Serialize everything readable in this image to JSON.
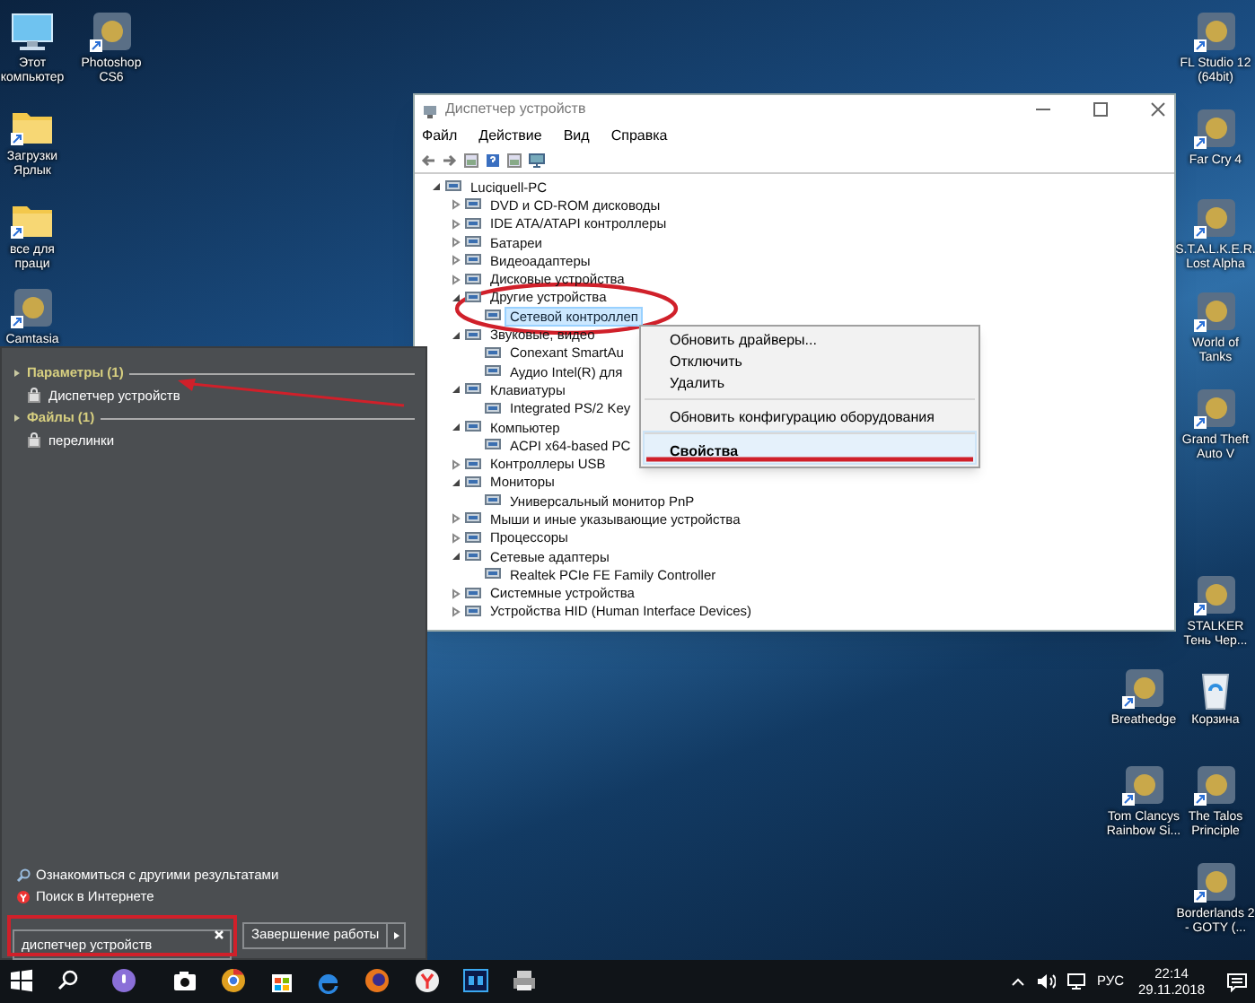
{
  "desktop_icons": [
    {
      "label": "Этот компьютер",
      "kind": "computer"
    },
    {
      "label": "Photoshop CS6",
      "kind": "app"
    },
    {
      "label": "Загрузки Ярлык",
      "kind": "folder"
    },
    {
      "label": "все для праци",
      "kind": "folder"
    },
    {
      "label": "Camtasia",
      "kind": "app"
    },
    {
      "label": "FL Studio 12 (64bit)",
      "kind": "app"
    },
    {
      "label": "Far Cry 4",
      "kind": "app"
    },
    {
      "label": "S.T.A.L.K.E.R. Lost Alpha",
      "kind": "app"
    },
    {
      "label": "World of Tanks",
      "kind": "app"
    },
    {
      "label": "Grand Theft Auto V",
      "kind": "app"
    },
    {
      "label": "STALKER Тень Чер...",
      "kind": "app"
    },
    {
      "label": "Breathedge",
      "kind": "app"
    },
    {
      "label": "Корзина",
      "kind": "bin"
    },
    {
      "label": "Tom Clancys Rainbow Si...",
      "kind": "app"
    },
    {
      "label": "The Talos Principle",
      "kind": "app"
    },
    {
      "label": "Borderlands 2 - GOTY (...",
      "kind": "app"
    }
  ],
  "device_manager": {
    "title": "Диспетчер устройств",
    "menu": [
      "Файл",
      "Действие",
      "Вид",
      "Справка"
    ],
    "tree": [
      {
        "label": "Luciquell-PC",
        "expanded": true,
        "selected": false,
        "children": [
          {
            "label": "DVD и CD-ROM дисководы",
            "expanded": false,
            "selected": false
          },
          {
            "label": "IDE ATA/ATAPI контроллеры",
            "expanded": false,
            "selected": false
          },
          {
            "label": "Батареи",
            "expanded": false,
            "selected": false
          },
          {
            "label": "Видеоадаптеры",
            "expanded": false,
            "selected": false
          },
          {
            "label": "Дисковые устройства",
            "expanded": false,
            "selected": false
          },
          {
            "label": "Другие устройства",
            "expanded": true,
            "selected": false,
            "children": [
              {
                "label": "Сетевой контроллеп",
                "selected": true
              }
            ]
          },
          {
            "label": "Звуковые, видео",
            "expanded": true,
            "selected": false,
            "children": [
              {
                "label": "Conexant SmartAu",
                "selected": false
              },
              {
                "label": "Аудио Intel(R) для",
                "selected": false
              }
            ]
          },
          {
            "label": "Клавиатуры",
            "expanded": true,
            "selected": false,
            "children": [
              {
                "label": "Integrated PS/2 Key",
                "selected": false
              }
            ]
          },
          {
            "label": "Компьютер",
            "expanded": true,
            "selected": false,
            "children": [
              {
                "label": "ACPI x64-based PC",
                "selected": false
              }
            ]
          },
          {
            "label": "Контроллеры USB",
            "expanded": false,
            "selected": false
          },
          {
            "label": "Мониторы",
            "expanded": true,
            "selected": false,
            "children": [
              {
                "label": "Универсальный монитор PnP",
                "selected": false
              }
            ]
          },
          {
            "label": "Мыши и иные указывающие устройства",
            "expanded": false,
            "selected": false
          },
          {
            "label": "Процессоры",
            "expanded": false,
            "selected": false
          },
          {
            "label": "Сетевые адаптеры",
            "expanded": true,
            "selected": false,
            "children": [
              {
                "label": "Realtek PCIe FE Family Controller",
                "selected": false
              }
            ]
          },
          {
            "label": "Системные устройства",
            "expanded": false,
            "selected": false
          },
          {
            "label": "Устройства HID (Human Interface Devices)",
            "expanded": false,
            "selected": false
          }
        ]
      }
    ]
  },
  "context_menu": [
    {
      "label": "Обновить драйверы...",
      "separator_before": false,
      "selected": false,
      "default": false
    },
    {
      "label": "Отключить",
      "separator_before": false,
      "selected": false,
      "default": false
    },
    {
      "label": "Удалить",
      "separator_before": false,
      "selected": false,
      "default": false
    },
    {
      "label": "Обновить конфигурацию оборудования",
      "separator_before": true,
      "selected": false,
      "default": false
    },
    {
      "label": "Свойства",
      "separator_before": true,
      "selected": true,
      "default": true
    }
  ],
  "start_menu": {
    "groups": [
      {
        "title": "Параметры (1)",
        "items": [
          "Диспетчер устройств"
        ]
      },
      {
        "title": "Файлы (1)",
        "items": [
          "перелинки"
        ]
      }
    ],
    "links": [
      "Ознакомиться с другими результатами",
      "Поиск в Интернете"
    ],
    "search": {
      "value": "диспетчер устройств"
    },
    "shutdown": "Завершение работы"
  },
  "tray": {
    "language": "РУС",
    "time": "22:14",
    "date": "29.11.2018"
  }
}
